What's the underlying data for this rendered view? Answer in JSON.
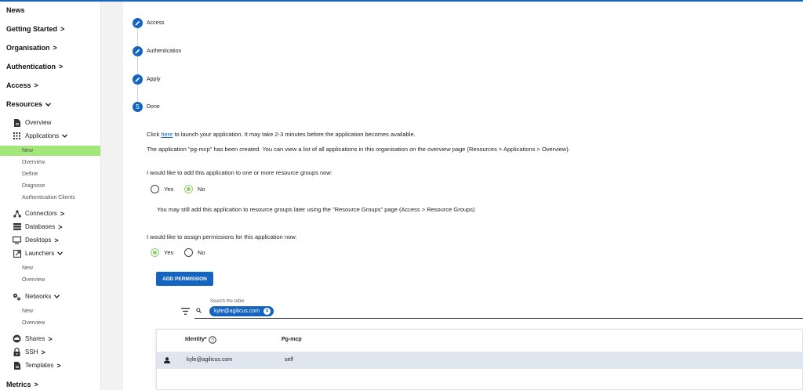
{
  "sidebar": {
    "top_items": [
      {
        "label": "News",
        "chevron": ""
      },
      {
        "label": "Getting Started",
        "chevron": ">"
      },
      {
        "label": "Organisation",
        "chevron": ">"
      },
      {
        "label": "Authentication",
        "chevron": ">"
      },
      {
        "label": "Access",
        "chevron": ">"
      },
      {
        "label": "Resources",
        "chevron": "v"
      }
    ],
    "resources": {
      "overview": "Overview",
      "applications": "Applications",
      "app_leaves": [
        "New",
        "Overview",
        "Define",
        "Diagnose",
        "Authentication Clients"
      ],
      "connectors": "Connectors",
      "databases": "Databases",
      "desktops": "Desktops",
      "launchers": "Launchers",
      "launcher_leaves": [
        "New",
        "Overview"
      ],
      "networks": "Networks",
      "network_leaves": [
        "New",
        "Overview"
      ],
      "shares": "Shares",
      "ssh": "SSH",
      "templates": "Templates"
    },
    "metrics": "Metrics",
    "active_color": "#a3e67a"
  },
  "steps": [
    {
      "label": "Access",
      "icon": "pencil-icon",
      "marker": ""
    },
    {
      "label": "Authentication",
      "icon": "pencil-icon",
      "marker": ""
    },
    {
      "label": "Apply",
      "icon": "pencil-icon",
      "marker": ""
    },
    {
      "label": "Done",
      "icon": "",
      "marker": "5"
    }
  ],
  "done": {
    "click_prefix": "Click ",
    "here_link": "here",
    "click_suffix": " to launch your application. It may take 2-3 minutes before the application becomes available.",
    "created_msg": "The application \"pg-mcp\" has been created. You can view a list of all applications in this organisation on the overview page (Resources > Applications > Overview).",
    "groups_question": "I would like to add this application to one or more resource groups now:",
    "groups_yes": "Yes",
    "groups_no": "No",
    "groups_selected": "No",
    "groups_note": "You may still add this application to resource groups later using the \"Resource Groups\" page (Access > Resource Groups)",
    "perm_question": "I would like to assign permissions for this application now:",
    "perm_yes": "Yes",
    "perm_no": "No",
    "perm_selected": "Yes",
    "add_permission": "ADD PERMISSION"
  },
  "search": {
    "label": "Search the table",
    "chip": "kyle@agilicus.com"
  },
  "table": {
    "headers": [
      "Identity*",
      "Pg-mcp"
    ],
    "rows": [
      {
        "identity": "kyle@agilicus.com",
        "permission": "self"
      }
    ]
  },
  "colors": {
    "primary": "#1565c0",
    "radio_selected": "#8bd16a",
    "row_highlight": "#dfe6ef"
  }
}
